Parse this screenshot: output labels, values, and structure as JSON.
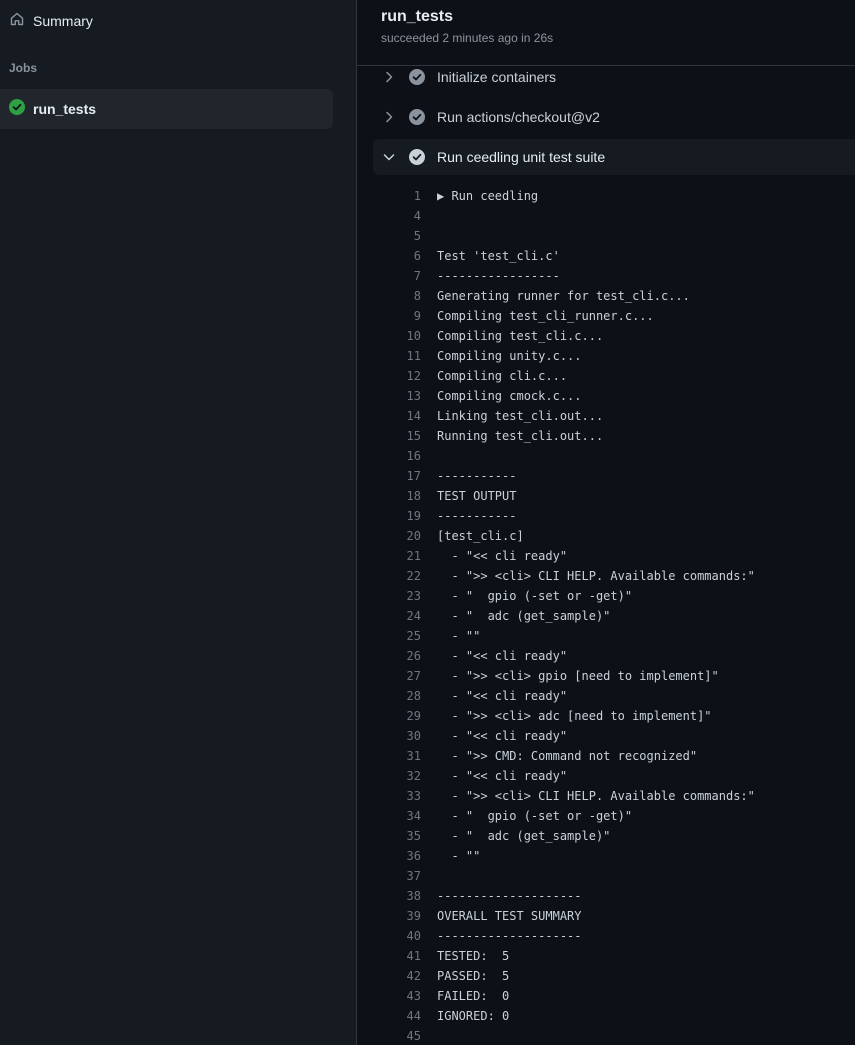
{
  "sidebar": {
    "summary_label": "Summary",
    "jobs_heading": "Jobs",
    "job": {
      "name": "run_tests",
      "status": "success"
    }
  },
  "header": {
    "title": "run_tests",
    "status": "succeeded 2 minutes ago in 26s"
  },
  "steps": [
    {
      "label": "Initialize containers",
      "expanded": false
    },
    {
      "label": "Run actions/checkout@v2",
      "expanded": false
    },
    {
      "label": "Run ceedling unit test suite",
      "expanded": true
    }
  ],
  "log_lines": [
    {
      "n": "1",
      "t": "▶ Run ceedling"
    },
    {
      "n": "4",
      "t": ""
    },
    {
      "n": "5",
      "t": ""
    },
    {
      "n": "6",
      "t": "Test 'test_cli.c'"
    },
    {
      "n": "7",
      "t": "-----------------"
    },
    {
      "n": "8",
      "t": "Generating runner for test_cli.c..."
    },
    {
      "n": "9",
      "t": "Compiling test_cli_runner.c..."
    },
    {
      "n": "10",
      "t": "Compiling test_cli.c..."
    },
    {
      "n": "11",
      "t": "Compiling unity.c..."
    },
    {
      "n": "12",
      "t": "Compiling cli.c..."
    },
    {
      "n": "13",
      "t": "Compiling cmock.c..."
    },
    {
      "n": "14",
      "t": "Linking test_cli.out..."
    },
    {
      "n": "15",
      "t": "Running test_cli.out..."
    },
    {
      "n": "16",
      "t": ""
    },
    {
      "n": "17",
      "t": "-----------"
    },
    {
      "n": "18",
      "t": "TEST OUTPUT"
    },
    {
      "n": "19",
      "t": "-----------"
    },
    {
      "n": "20",
      "t": "[test_cli.c]"
    },
    {
      "n": "21",
      "t": "  - \"<< cli ready\""
    },
    {
      "n": "22",
      "t": "  - \">> <cli> CLI HELP. Available commands:\""
    },
    {
      "n": "23",
      "t": "  - \"  gpio (-set or -get)\""
    },
    {
      "n": "24",
      "t": "  - \"  adc (get_sample)\""
    },
    {
      "n": "25",
      "t": "  - \"\""
    },
    {
      "n": "26",
      "t": "  - \"<< cli ready\""
    },
    {
      "n": "27",
      "t": "  - \">> <cli> gpio [need to implement]\""
    },
    {
      "n": "28",
      "t": "  - \"<< cli ready\""
    },
    {
      "n": "29",
      "t": "  - \">> <cli> adc [need to implement]\""
    },
    {
      "n": "30",
      "t": "  - \"<< cli ready\""
    },
    {
      "n": "31",
      "t": "  - \">> CMD: Command not recognized\""
    },
    {
      "n": "32",
      "t": "  - \"<< cli ready\""
    },
    {
      "n": "33",
      "t": "  - \">> <cli> CLI HELP. Available commands:\""
    },
    {
      "n": "34",
      "t": "  - \"  gpio (-set or -get)\""
    },
    {
      "n": "35",
      "t": "  - \"  adc (get_sample)\""
    },
    {
      "n": "36",
      "t": "  - \"\""
    },
    {
      "n": "37",
      "t": ""
    },
    {
      "n": "38",
      "t": "--------------------"
    },
    {
      "n": "39",
      "t": "OVERALL TEST SUMMARY"
    },
    {
      "n": "40",
      "t": "--------------------"
    },
    {
      "n": "41",
      "t": "TESTED:  5"
    },
    {
      "n": "42",
      "t": "PASSED:  5"
    },
    {
      "n": "43",
      "t": "FAILED:  0"
    },
    {
      "n": "44",
      "t": "IGNORED: 0"
    },
    {
      "n": "45",
      "t": ""
    }
  ],
  "colors": {
    "success": "#2ea043",
    "step_check": "#8b949e",
    "background": "#0d1117",
    "sidebar": "#161b22"
  },
  "icons": {
    "summary": "home-icon",
    "job_status": "check-circle-icon",
    "step_status": "check-circle-icon",
    "collapsed": "chevron-right-icon",
    "expanded": "chevron-down-icon"
  }
}
